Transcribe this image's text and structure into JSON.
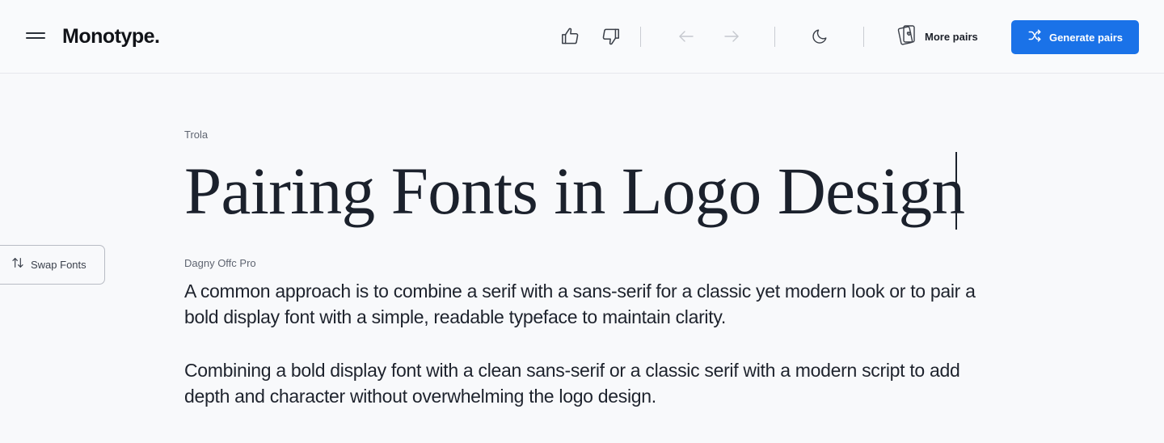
{
  "header": {
    "logo": "Monotype.",
    "more_pairs_label": "More pairs",
    "generate_label": "Generate pairs",
    "accent_color": "#1a72e8"
  },
  "icons": {
    "menu": "hamburger-menu-icon",
    "like": "thumbs-up-icon",
    "dislike": "thumbs-down-icon",
    "back": "arrow-left-icon",
    "forward": "arrow-right-icon",
    "theme": "moon-icon",
    "more_pairs": "cards-icon",
    "generate": "shuffle-icon",
    "swap": "swap-arrows-icon"
  },
  "main": {
    "heading_font_name": "Trola",
    "headline": "Pairing Fonts in Logo Design",
    "body_font_name": "Dagny Offc Pro",
    "paragraphs": [
      "A common approach is to combine a serif with a sans-serif for a classic yet modern look or to pair a bold display font with a simple, readable typeface to maintain clarity.",
      "Combining a bold display font with a clean sans-serif or a classic serif with a modern script to add depth and character without overwhelming the logo design."
    ]
  },
  "swap": {
    "label": "Swap Fonts"
  }
}
